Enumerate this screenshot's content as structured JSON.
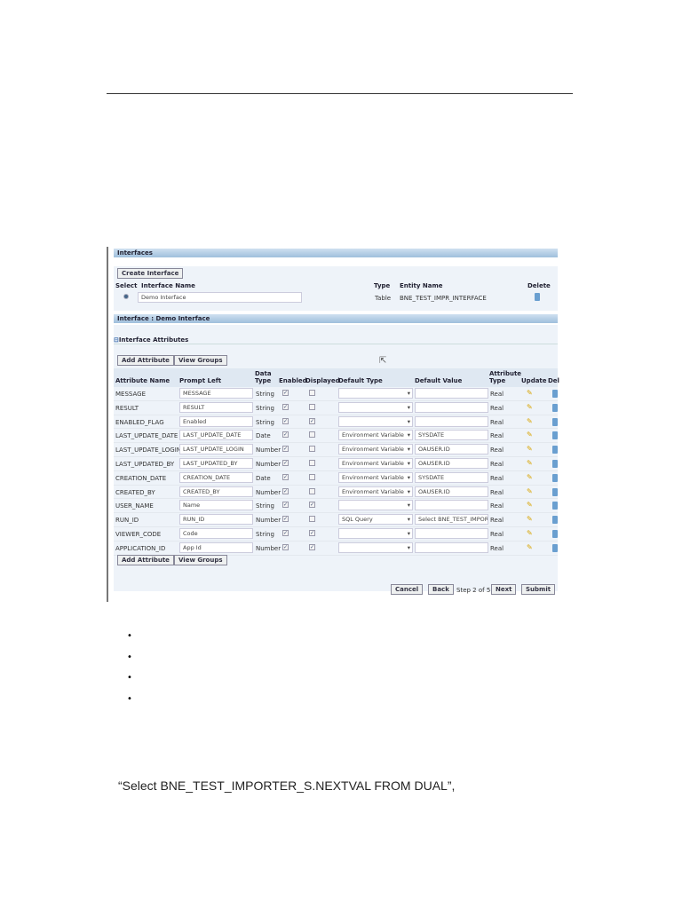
{
  "interfaces": {
    "header": "Interfaces",
    "create_button": "Create Interface",
    "cols": [
      "Select",
      "Interface Name",
      "Type",
      "Entity Name",
      "Delete"
    ],
    "row": {
      "name": "Demo Interface",
      "type": "Table",
      "entity": "BNE_TEST_IMPR_INTERFACE"
    }
  },
  "detail": {
    "header": "Interface : Demo Interface",
    "section": "Interface Attributes",
    "add_attribute": "Add Attribute",
    "view_groups": "View Groups",
    "cols": [
      "Attribute Name",
      "Prompt Left",
      "Data Type",
      "Enabled",
      "Displayed",
      "Default Type",
      "Default Value",
      "Attribute Type",
      "Update",
      "Delete"
    ],
    "rows": [
      {
        "name": "MESSAGE",
        "prompt": "MESSAGE",
        "type": "String",
        "enabled": true,
        "displayed": false,
        "default_type": "",
        "default_value": "",
        "attr_type": "Real"
      },
      {
        "name": "RESULT",
        "prompt": "RESULT",
        "type": "String",
        "enabled": true,
        "displayed": false,
        "default_type": "",
        "default_value": "",
        "attr_type": "Real"
      },
      {
        "name": "ENABLED_FLAG",
        "prompt": "Enabled",
        "type": "String",
        "enabled": true,
        "displayed": true,
        "default_type": "",
        "default_value": "",
        "attr_type": "Real"
      },
      {
        "name": "LAST_UPDATE_DATE",
        "prompt": "LAST_UPDATE_DATE",
        "type": "Date",
        "enabled": true,
        "displayed": false,
        "default_type": "Environment Variable",
        "default_value": "SYSDATE",
        "attr_type": "Real"
      },
      {
        "name": "LAST_UPDATE_LOGIN",
        "prompt": "LAST_UPDATE_LOGIN",
        "type": "Number",
        "enabled": true,
        "displayed": false,
        "default_type": "Environment Variable",
        "default_value": "OAUSER.ID",
        "attr_type": "Real"
      },
      {
        "name": "LAST_UPDATED_BY",
        "prompt": "LAST_UPDATED_BY",
        "type": "Number",
        "enabled": true,
        "displayed": false,
        "default_type": "Environment Variable",
        "default_value": "OAUSER.ID",
        "attr_type": "Real"
      },
      {
        "name": "CREATION_DATE",
        "prompt": "CREATION_DATE",
        "type": "Date",
        "enabled": true,
        "displayed": false,
        "default_type": "Environment Variable",
        "default_value": "SYSDATE",
        "attr_type": "Real"
      },
      {
        "name": "CREATED_BY",
        "prompt": "CREATED_BY",
        "type": "Number",
        "enabled": true,
        "displayed": false,
        "default_type": "Environment Variable",
        "default_value": "OAUSER.ID",
        "attr_type": "Real"
      },
      {
        "name": "USER_NAME",
        "prompt": "Name",
        "type": "String",
        "enabled": true,
        "displayed": true,
        "default_type": "",
        "default_value": "",
        "attr_type": "Real"
      },
      {
        "name": "RUN_ID",
        "prompt": "RUN_ID",
        "type": "Number",
        "enabled": true,
        "displayed": false,
        "default_type": "SQL Query",
        "default_value": "Select BNE_TEST_IMPOR",
        "attr_type": "Real"
      },
      {
        "name": "VIEWER_CODE",
        "prompt": "Code",
        "type": "String",
        "enabled": true,
        "displayed": true,
        "default_type": "",
        "default_value": "",
        "attr_type": "Real"
      },
      {
        "name": "APPLICATION_ID",
        "prompt": "App Id",
        "type": "Number",
        "enabled": true,
        "displayed": true,
        "default_type": "",
        "default_value": "",
        "attr_type": "Real"
      }
    ]
  },
  "nav": {
    "cancel": "Cancel",
    "back": "Back",
    "step": "Step 2 of 5",
    "next": "Next",
    "submit": "Submit"
  },
  "quote": "“Select BNE_TEST_IMPORTER_S.NEXTVAL FROM DUAL”,"
}
